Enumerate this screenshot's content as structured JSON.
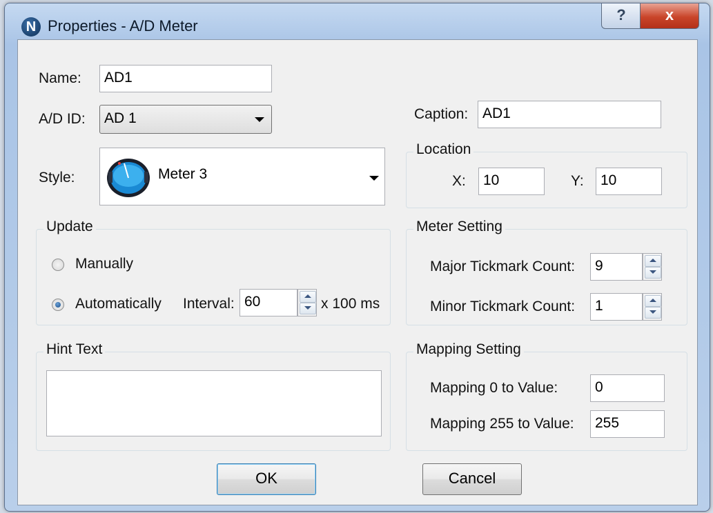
{
  "window": {
    "title": "Properties - A/D Meter",
    "app_icon_letter": "N",
    "help_label": "?",
    "close_label": "x"
  },
  "name": {
    "label": "Name:",
    "value": "AD1"
  },
  "ad_id": {
    "label": "A/D ID:",
    "selected": "AD 1"
  },
  "caption": {
    "label": "Caption:",
    "value": "AD1"
  },
  "style": {
    "label": "Style:",
    "selected": "Meter 3",
    "icon": "meter-gauge-icon"
  },
  "location": {
    "title": "Location",
    "x_label": "X:",
    "x_value": "10",
    "y_label": "Y:",
    "y_value": "10"
  },
  "update": {
    "title": "Update",
    "manual_label": "Manually",
    "auto_label": "Automatically",
    "selected": "Automatically",
    "interval_label": "Interval:",
    "interval_value": "60",
    "interval_unit": "x 100 ms"
  },
  "meter_setting": {
    "title": "Meter Setting",
    "major_label": "Major Tickmark Count:",
    "major_value": "9",
    "minor_label": "Minor Tickmark Count:",
    "minor_value": "1"
  },
  "hint": {
    "title": "Hint Text",
    "value": ""
  },
  "mapping": {
    "title": "Mapping Setting",
    "map0_label": "Mapping 0 to Value:",
    "map0_value": "0",
    "map255_label": "Mapping 255 to Value:",
    "map255_value": "255"
  },
  "buttons": {
    "ok": "OK",
    "cancel": "Cancel"
  },
  "colors": {
    "title_bar": "#b9cfea",
    "close_button": "#c9452a",
    "client_bg": "#f0f0f0"
  }
}
